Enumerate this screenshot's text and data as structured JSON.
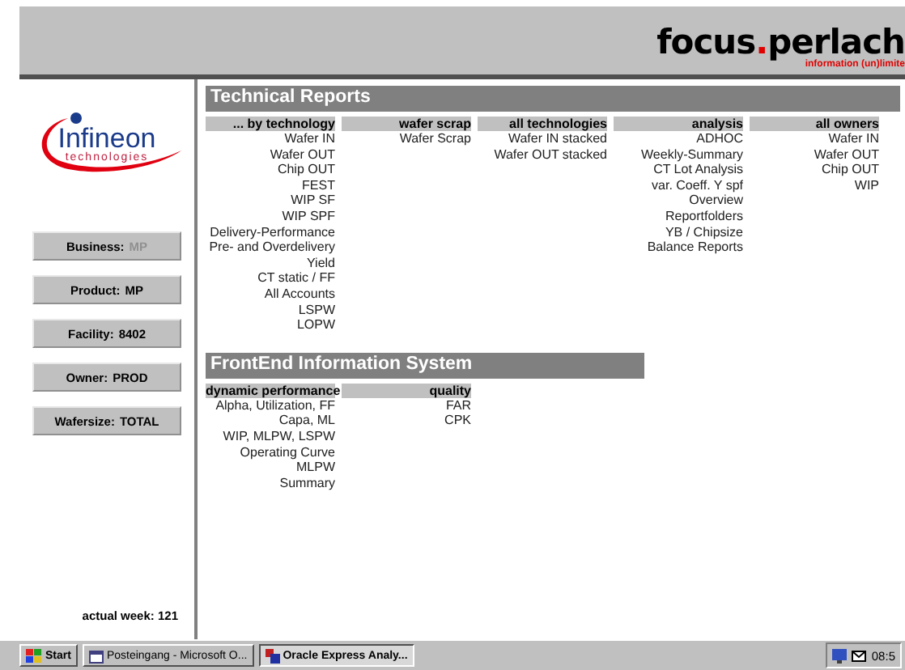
{
  "header": {
    "brand_first": "focus",
    "brand_dot": ".",
    "brand_second": "perlach",
    "tagline": "information (un)limite"
  },
  "logo": {
    "name": "Infineon",
    "sub": "technologies"
  },
  "filters": [
    {
      "label": "Business:",
      "value": "MP",
      "disabled": true
    },
    {
      "label": "Product:",
      "value": "MP",
      "disabled": false
    },
    {
      "label": "Facility:",
      "value": "8402",
      "disabled": false
    },
    {
      "label": "Owner:",
      "value": "PROD",
      "disabled": false
    },
    {
      "label": "Wafersize:",
      "value": "TOTAL",
      "disabled": false
    }
  ],
  "actual_week": "actual week: 121",
  "sections": [
    {
      "title": "Technical Reports",
      "columns": [
        {
          "heading": "... by technology",
          "links": [
            "Wafer IN",
            "Wafer OUT",
            "Chip OUT",
            "FEST",
            "WIP SF",
            "WIP SPF",
            "Delivery-Performance",
            "Pre- and Overdelivery",
            "Yield",
            "CT static / FF",
            "All Accounts",
            "LSPW",
            "LOPW"
          ]
        },
        {
          "heading": "wafer scrap",
          "links": [
            "Wafer Scrap"
          ]
        },
        {
          "heading": "all technologies",
          "links": [
            "Wafer IN stacked",
            "Wafer OUT stacked"
          ]
        },
        {
          "heading": "analysis",
          "links": [
            "ADHOC",
            "Weekly-Summary",
            "CT Lot Analysis",
            "var. Coeff. Y spf",
            "Overview",
            "Reportfolders",
            "YB / Chipsize",
            "Balance Reports"
          ]
        },
        {
          "heading": "all owners",
          "links": [
            "Wafer IN",
            "Wafer OUT",
            "Chip OUT",
            "WIP"
          ]
        }
      ]
    },
    {
      "title": "FrontEnd Information System",
      "columns": [
        {
          "heading": "dynamic performance",
          "links": [
            "Alpha, Utilization, FF",
            "Capa, ML",
            "WIP, MLPW, LSPW",
            "Operating Curve",
            "MLPW",
            "Summary"
          ]
        },
        {
          "heading": "quality",
          "links": [
            "FAR",
            "CPK"
          ]
        }
      ]
    }
  ],
  "taskbar": {
    "start": "Start",
    "tasks": [
      {
        "label": "Posteingang - Microsoft O...",
        "selected": false
      },
      {
        "label": "Oracle Express Analy...",
        "selected": true
      }
    ],
    "clock": "08:5"
  }
}
